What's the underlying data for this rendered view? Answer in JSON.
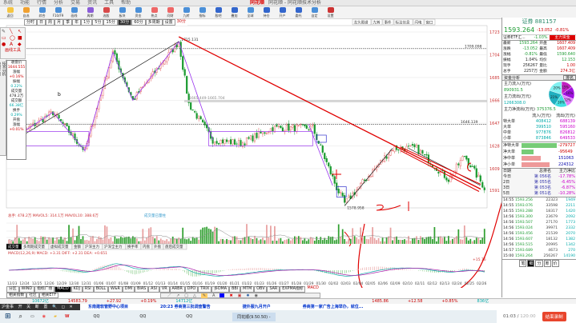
{
  "titlebar": {
    "menu": [
      "系统",
      "功能",
      "行情",
      "分析",
      "交易",
      "资讯",
      "工具",
      "帮助"
    ],
    "logo": "同花顺",
    "window": "同花顺 - 同花顺技术分析"
  },
  "toolbar": [
    "返回",
    "自选",
    "综合",
    "F10/F9",
    "画线",
    "周期",
    "选股",
    "板块",
    "资金",
    "热点",
    "问财",
    "九转",
    "指标",
    "股吧",
    "叠加",
    "全球",
    "持仓",
    "开户",
    "委托",
    "自定",
    "设置"
  ],
  "period": {
    "items": [
      "分时",
      "日",
      "周",
      "月",
      "季",
      "年",
      "1分",
      "5分",
      "15分",
      "30分",
      "60分",
      "多周期",
      "设置"
    ],
    "active": "30分"
  },
  "drawtools": {
    "label": "画线工具"
  },
  "vtabs": [
    "技术分析",
    "分时走势",
    "基本资料",
    "自选股",
    "上证指数"
  ],
  "info": [
    [
      "收盘价",
      "1644.555",
      "red"
    ],
    [
      "涨幅",
      "+0.16%",
      "red"
    ],
    [
      "振幅",
      "0.22%",
      "cyan"
    ],
    [
      "成交量",
      "478.2万",
      "#222"
    ],
    [
      "成交额",
      "66.38亿",
      "cyan"
    ],
    [
      "换手",
      "0.29%",
      "cyan"
    ],
    [
      "开盘",
      "",
      ""
    ],
    [
      "涨幅",
      "+0.01%",
      "red"
    ]
  ],
  "chart": {
    "yticks": [
      1723,
      1704,
      1685,
      1666,
      1647,
      1628,
      1609,
      1591
    ],
    "labels": {
      "high": "1715.131",
      "low": "1578.958",
      "dotted": "1709.098",
      "mid": "1646.139",
      "box": "1665.449-1665.704"
    },
    "topbar": [
      "龙头图谱",
      "九转",
      "事件",
      "标注信息",
      "闪电",
      "窗口"
    ],
    "keypoints": [
      [
        0,
        1632
      ],
      [
        22,
        1656
      ],
      [
        38,
        1624
      ],
      [
        52,
        1706
      ],
      [
        62,
        1666
      ],
      [
        85,
        1715
      ],
      [
        90,
        1663
      ],
      [
        102,
        1633
      ],
      [
        116,
        1630
      ],
      [
        132,
        1643
      ],
      [
        152,
        1643
      ],
      [
        164,
        1593
      ],
      [
        168,
        1580
      ],
      [
        192,
        1626
      ],
      [
        204,
        1626
      ],
      [
        220,
        1600
      ],
      [
        228,
        1620
      ],
      [
        238,
        1593
      ]
    ],
    "annotations": [
      "b"
    ],
    "dates": [
      "12/23",
      "12/24",
      "12/25",
      "12/26",
      "12/29",
      "12/30",
      "12/31",
      "01/06",
      "01/07",
      "01/08",
      "01/09",
      "01/12",
      "01/13",
      "01/14",
      "01/15",
      "01/16",
      "01/19",
      "01/20",
      "01/21",
      "01/22",
      "01/23",
      "01/26",
      "01/27",
      "01/28",
      "01/29",
      "01/30",
      "02/02",
      "02/03",
      "02/04",
      "02/05",
      "02/06",
      "02/09",
      "02/10",
      "02/11",
      "02/12",
      "02/13",
      "02/24",
      "02/25",
      "02/26"
    ]
  },
  "volume": {
    "legend": "总手: 478.2万 MAVOL5: 314.1万 MAVOL10: 388.6万",
    "legend_extra": "成交量已量柱",
    "tabs": [
      "成交量",
      "多周期成交量",
      "虚拟成交量",
      "金额",
      "沪深主力",
      "沪深全主力",
      "换手率",
      "内盘",
      "外盘",
      "盘后成交量"
    ]
  },
  "macd": {
    "legend": "MACD(12,26,9) MACD: +3.31 DIFF: +2.31 DEA: +0.651",
    "right_labels": [
      "+15.76",
      "0"
    ]
  },
  "bottomtabs": [
    "分区",
    "WIND",
    "指标广场",
    "",
    "MACD",
    "KDJ",
    "RSI",
    "BOLL",
    "W&R",
    "DMI",
    "BIAS",
    "ASI",
    "VR",
    "ARBR",
    "DPO",
    "TRIX",
    "多DMA",
    "BBI",
    "MTM",
    "OBV",
    "SAR",
    "EXPMA指标"
  ],
  "bottom_active": "MACD",
  "subtabs": [
    "相关指数",
    "社区",
    "相关ETF"
  ],
  "right": {
    "title": "证券 881157",
    "price": "1593.264",
    "change": "-13.052",
    "pct": "-0.81%",
    "etf": "证券ETF汇...",
    "etf_pct": "-1.03%",
    "etf_btn": "主力资金",
    "quote": [
      [
        "最新",
        "1593.264",
        "开盘",
        "1607.409"
      ],
      [
        "涨跌",
        "-13.052",
        "最高",
        "1607.409"
      ],
      [
        "涨幅",
        "-0.81%",
        "最低",
        "1590.640"
      ],
      [
        "振幅",
        "1.04%",
        "均价",
        "12.153"
      ],
      [
        "现手",
        "256267",
        "量比",
        "1.00"
      ],
      [
        "总手",
        "2257万",
        "金额",
        "274.3亿"
      ]
    ],
    "fund_title": "资金分析",
    "fund_btn": "排名",
    "inflow_label": "主力流入(万元)",
    "inflow": "890931.5",
    "outflow_label": "主力流出(万元)",
    "outflow": "1266308.0",
    "net_label": "主力净流出(万元)",
    "net": "375376.5",
    "pie": [
      {
        "label": "15%",
        "value": 15,
        "color": "#c020c0"
      },
      {
        "label": "16%",
        "value": 16,
        "color": "#a010e0"
      },
      {
        "label": "12%",
        "value": 12,
        "color": "#e080ff"
      },
      {
        "label": "16%",
        "value": 16,
        "color": "#40e0e0"
      },
      {
        "label": "21%",
        "value": 21,
        "color": "#20b0c0"
      },
      {
        "label": "20%",
        "value": 20,
        "color": "#80f0f0"
      }
    ],
    "flow_head": [
      "",
      "流入(万元)",
      "流出(万元)"
    ],
    "flow": [
      [
        "特大单",
        "408412",
        "688139"
      ],
      [
        "大单",
        "399510",
        "595160"
      ],
      [
        "中单",
        "977876",
        "826812"
      ],
      [
        "小单",
        "873846",
        "649533"
      ]
    ],
    "net_bars": [
      {
        "label": "净特大单",
        "value": -279727
      },
      {
        "label": "净大单",
        "value": -95649
      },
      {
        "label": "净中单",
        "value": 151063
      },
      {
        "label": "净小单",
        "value": 224312
      }
    ],
    "rank_head": [
      "日期",
      "总排名",
      "主力净比"
    ],
    "rank": [
      [
        "今日",
        "第 056名",
        "-17.78%"
      ],
      [
        "2日",
        "第 055名",
        "-6.45%"
      ],
      [
        "3日",
        "第 053名",
        "-6.87%"
      ],
      [
        "5日",
        "第 051名",
        "-10.28%"
      ]
    ],
    "ticks": [
      [
        "14:55",
        "1593.256",
        "22323",
        "1949"
      ],
      [
        "14:55",
        "1593.076",
        "33598",
        "2211"
      ],
      [
        "14:55",
        "1593.288",
        "18317",
        "1420"
      ],
      [
        "14:56",
        "1593.300",
        "23679",
        "2092"
      ],
      [
        "14:56",
        "1593.507",
        "27170",
        "1773"
      ],
      [
        "14:56",
        "1593.024",
        "39971",
        "2332"
      ],
      [
        "14:56",
        "1593.456",
        "21539",
        "2070"
      ],
      [
        "14:56",
        "1593.607",
        "18132",
        "1382"
      ],
      [
        "14:56",
        "1593.515",
        "20995",
        "1342"
      ],
      [
        "14:57",
        "1593.689",
        "4673",
        "270"
      ],
      [
        "15:00",
        "1593.264",
        "256267",
        "14190"
      ]
    ],
    "tick_tabs": [
      "笔",
      "细",
      "分",
      "筹",
      "价"
    ]
  },
  "status": [
    [
      "14583.79",
      "+27.92",
      "+0.19%",
      "14712亿"
    ],
    [
      "1485.86",
      "+12.58",
      "+0.85%",
      "836亿"
    ]
  ],
  "status_left": "10672亿",
  "ticker": [
    "东南建软管野中心项目",
    "20:23 券商第三批调查警告",
    "捷外服九月开户",
    "券商第一家广告上海举办，就位..."
  ],
  "darkbar": "沪金事 开 关 断 置 🔍 ◻ ✕",
  "taskbar": [
    "QQ",
    "QQ",
    "QQ",
    "同花顺(9.50.50) -"
  ],
  "recording": {
    "time": "01:03",
    "total": "120:00",
    "button": "结束录制"
  },
  "colors": {
    "up": "#e05050",
    "down": "#1a9a30",
    "annot": "#e00000",
    "purple": "#9933ee"
  }
}
